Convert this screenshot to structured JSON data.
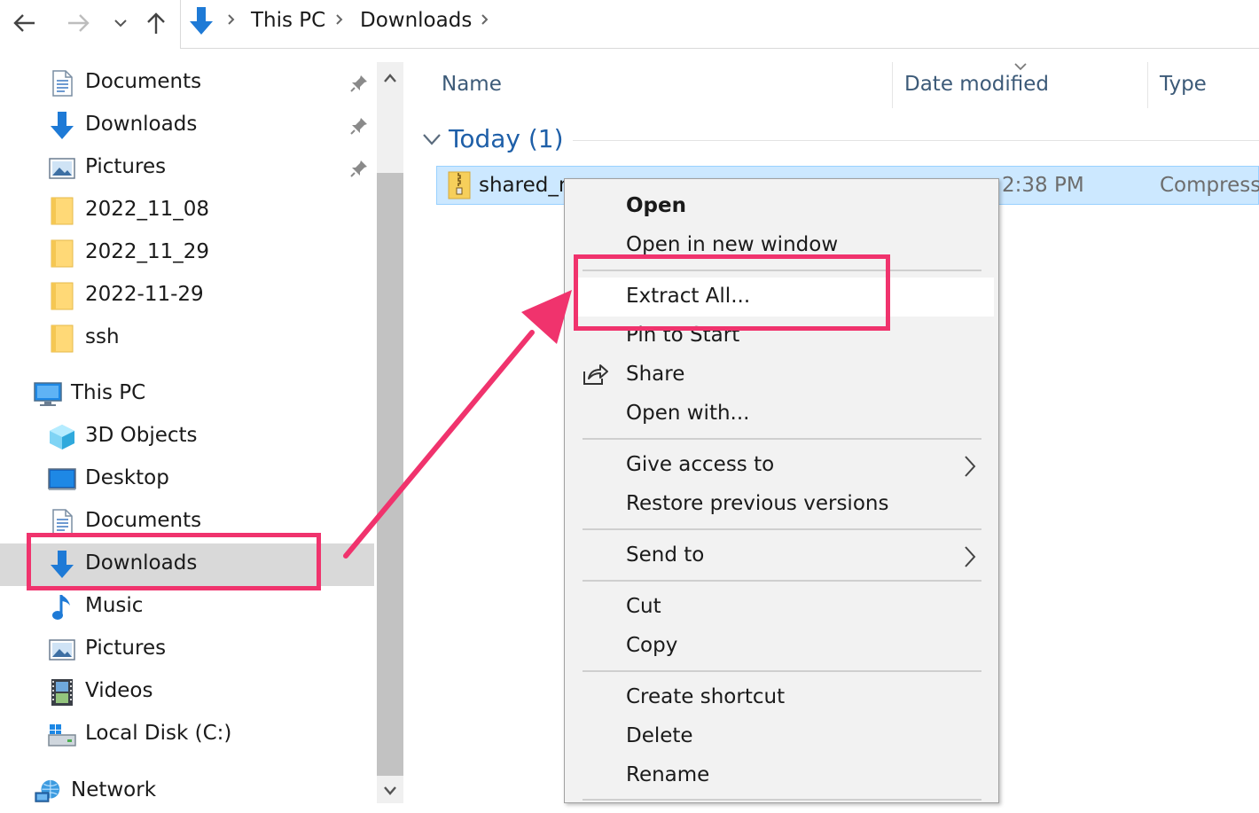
{
  "address_bar": {
    "breadcrumbs": [
      "This PC",
      "Downloads"
    ]
  },
  "nav_pane": {
    "quick_access": [
      {
        "label": "Documents",
        "icon": "documents-icon",
        "pinned": true
      },
      {
        "label": "Downloads",
        "icon": "downloads-icon",
        "pinned": true
      },
      {
        "label": "Pictures",
        "icon": "pictures-icon",
        "pinned": true
      },
      {
        "label": "2022_11_08",
        "icon": "folder-icon"
      },
      {
        "label": "2022_11_29",
        "icon": "folder-icon"
      },
      {
        "label": "2022-11-29",
        "icon": "folder-icon"
      },
      {
        "label": "ssh",
        "icon": "folder-icon"
      }
    ],
    "this_pc": {
      "label": "This PC",
      "icon": "this-pc-icon"
    },
    "this_pc_items": [
      {
        "label": "3D Objects",
        "icon": "3d-objects-icon"
      },
      {
        "label": "Desktop",
        "icon": "desktop-icon"
      },
      {
        "label": "Documents",
        "icon": "documents-icon"
      },
      {
        "label": "Downloads",
        "icon": "downloads-icon",
        "selected": true
      },
      {
        "label": "Music",
        "icon": "music-icon"
      },
      {
        "label": "Pictures",
        "icon": "pictures-icon"
      },
      {
        "label": "Videos",
        "icon": "videos-icon"
      },
      {
        "label": "Local Disk (C:)",
        "icon": "local-disk-icon"
      }
    ],
    "network": {
      "label": "Network",
      "icon": "network-icon"
    }
  },
  "file_list": {
    "columns": [
      "Name",
      "Date modified",
      "Type"
    ],
    "group": {
      "label": "Today (1)"
    },
    "files": [
      {
        "name": "shared_m",
        "date_modified": "2:38 PM",
        "type": "Compresse",
        "icon": "zip-folder-icon"
      }
    ]
  },
  "context_menu": {
    "items": [
      {
        "label": "Open",
        "bold": true
      },
      {
        "label": "Open in new window"
      },
      {
        "separator": true
      },
      {
        "label": "Extract All...",
        "highlighted": true
      },
      {
        "label": "Pin to Start"
      },
      {
        "label": "Share",
        "icon": "share-icon"
      },
      {
        "label": "Open with..."
      },
      {
        "separator": true
      },
      {
        "label": "Give access to",
        "submenu": true
      },
      {
        "label": "Restore previous versions"
      },
      {
        "separator": true
      },
      {
        "label": "Send to",
        "submenu": true
      },
      {
        "separator": true
      },
      {
        "label": "Cut"
      },
      {
        "label": "Copy"
      },
      {
        "separator": true
      },
      {
        "label": "Create shortcut"
      },
      {
        "label": "Delete"
      },
      {
        "label": "Rename"
      }
    ]
  },
  "colors": {
    "annotation": "#f0336d",
    "selection": "#cce8ff",
    "group_header": "#1e5fa8",
    "column_header": "#3c5a78"
  }
}
